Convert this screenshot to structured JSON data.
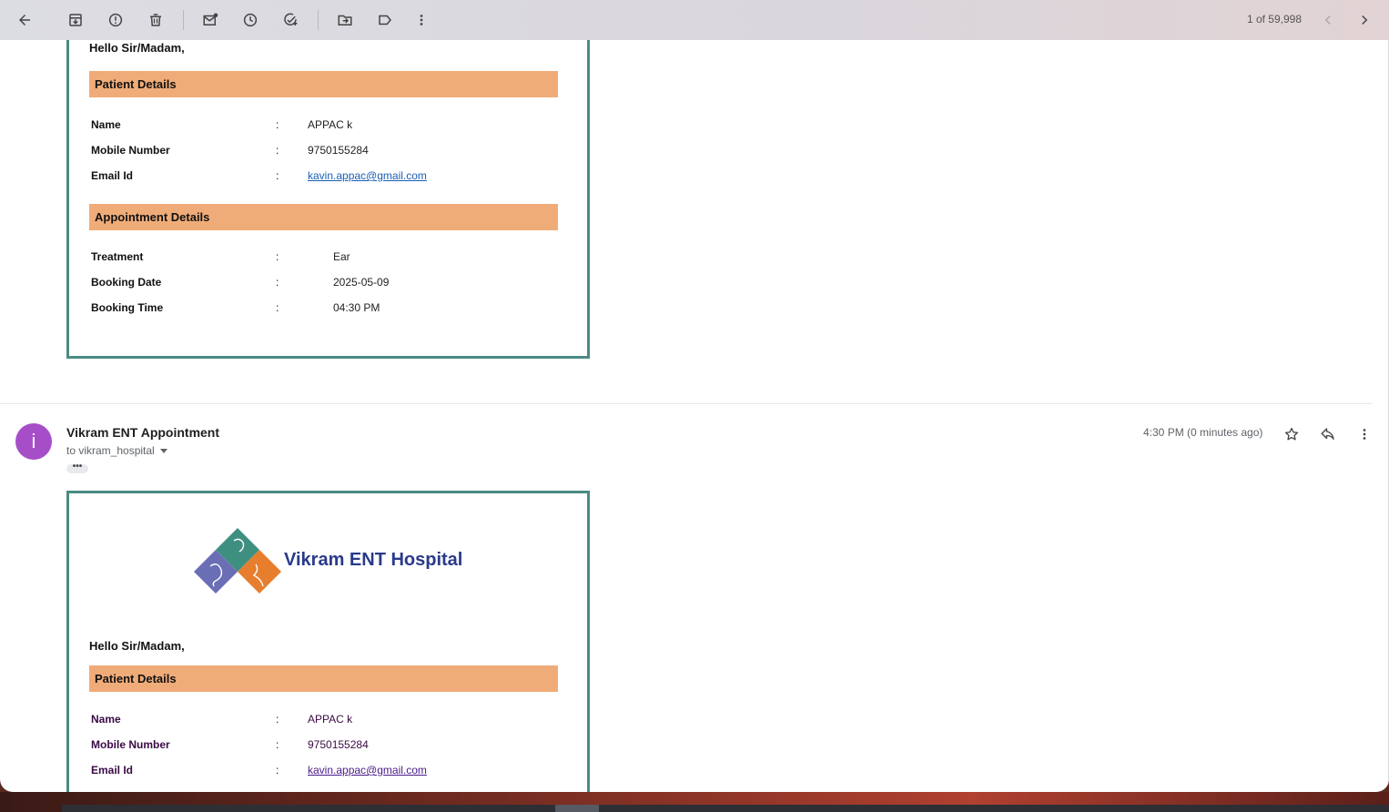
{
  "toolbar": {
    "pager": "1 of 59,998",
    "icons": [
      "back-arrow-icon",
      "archive-icon",
      "report-spam-icon",
      "delete-icon",
      "mark-unread-icon",
      "snooze-icon",
      "add-task-icon",
      "move-to-icon",
      "label-icon",
      "more-vert-icon",
      "chevron-left-icon",
      "chevron-right-icon"
    ]
  },
  "message1": {
    "greeting": "Hello Sir/Madam,",
    "patient_heading": "Patient Details",
    "patient_rows": [
      {
        "label": "Name",
        "colon": ":",
        "value": "APPAC k"
      },
      {
        "label": "Mobile Number",
        "colon": ":",
        "value": "9750155284"
      },
      {
        "label": "Email Id",
        "colon": ":",
        "value": "kavin.appac@gmail.com"
      }
    ],
    "appointment_heading": "Appointment Details",
    "appointment_rows": [
      {
        "label": "Treatment",
        "colon": ":",
        "value": "Ear"
      },
      {
        "label": "Booking Date",
        "colon": ":",
        "value": "2025-05-09"
      },
      {
        "label": "Booking Time",
        "colon": ":",
        "value": "04:30 PM"
      }
    ]
  },
  "message2": {
    "avatar_letter": "i",
    "sender": "Vikram ENT Appointment",
    "to": "to vikram_hospital",
    "time": "4:30 PM (0 minutes ago)",
    "dots": "•••",
    "logo_text": "Vikram ENT Hospital",
    "greeting": "Hello Sir/Madam,",
    "patient_heading": "Patient Details",
    "patient_rows": [
      {
        "label": "Name",
        "colon": ":",
        "value": "APPAC k"
      },
      {
        "label": "Mobile Number",
        "colon": ":",
        "value": "9750155284"
      },
      {
        "label": "Email Id",
        "colon": ":",
        "value": "kavin.appac@gmail.com"
      }
    ]
  },
  "colors": {
    "card_border": "#4a8b84",
    "section_header": "#efac78",
    "avatar": "#a64ec8",
    "logo_teal": "#3f8f80",
    "logo_purple": "#6a6fb5",
    "logo_orange": "#e67e2e",
    "logo_text": "#2a3a8a"
  }
}
